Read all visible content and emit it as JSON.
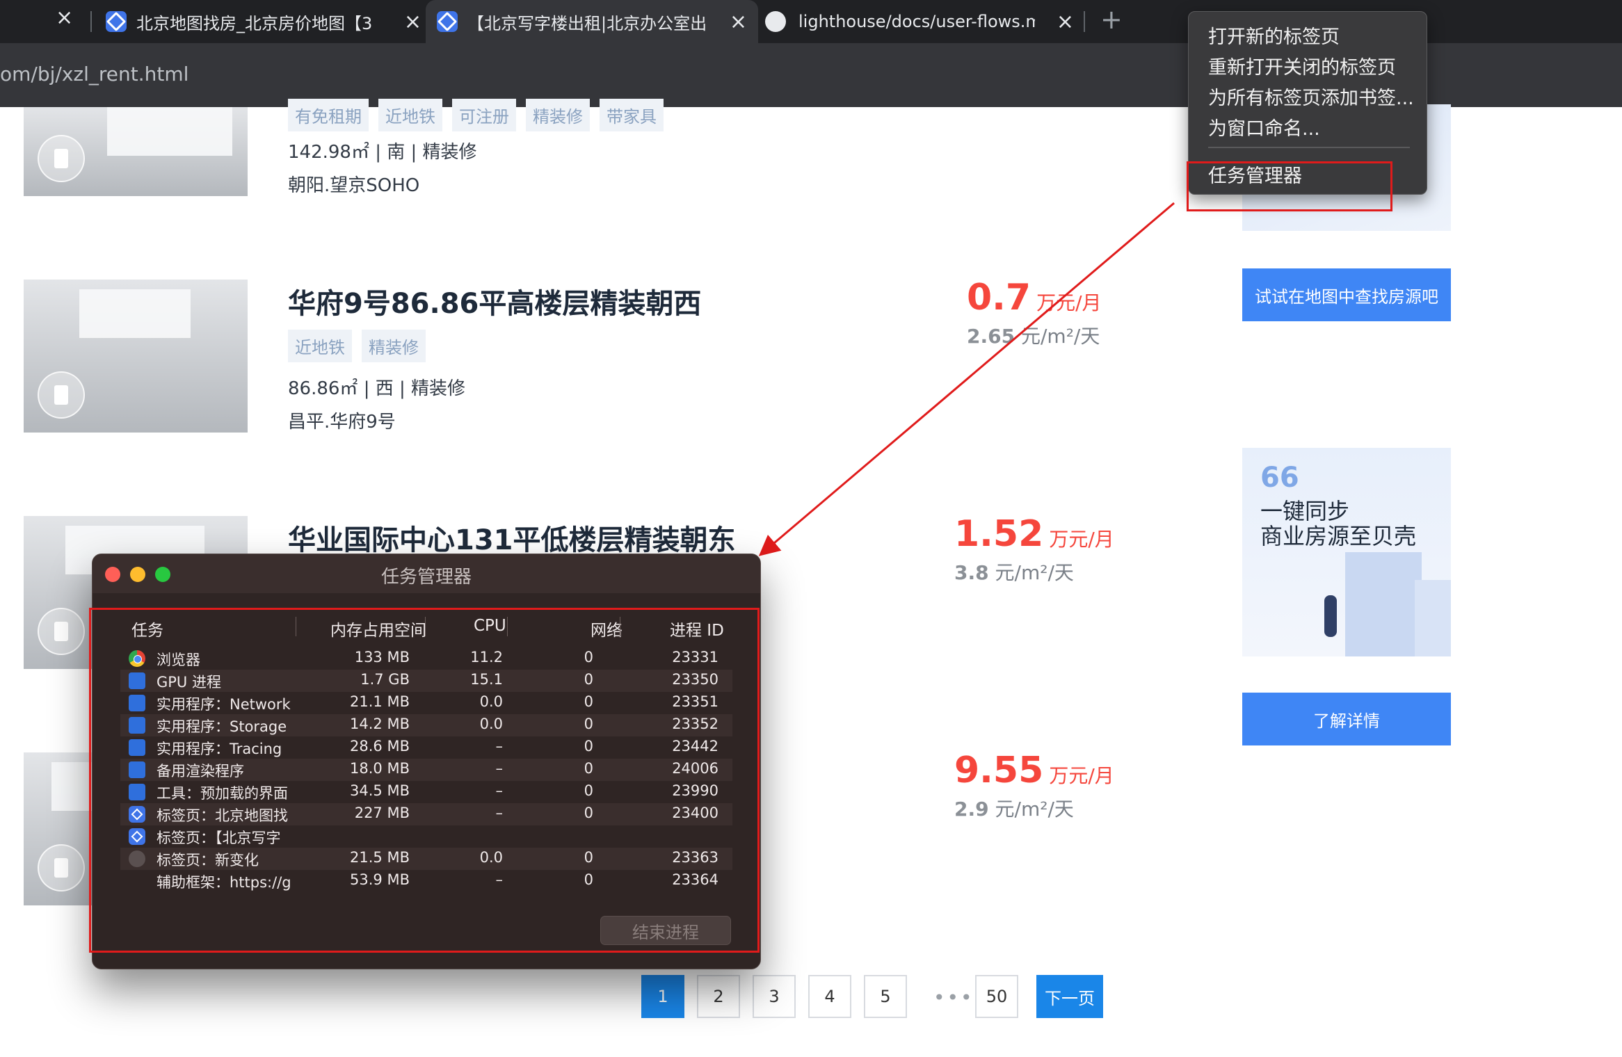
{
  "browser": {
    "tabs": [
      {
        "title": "北京地图找房_北京房价地图【3",
        "active": false
      },
      {
        "title": "【北京写字楼出租|北京办公室出",
        "active": true
      },
      {
        "title": "lighthouse/docs/user-flows.m",
        "active": false
      }
    ],
    "url": "om/bj/xzl_rent.html"
  },
  "listings": [
    {
      "tags": [
        "有免租期",
        "近地铁",
        "可注册",
        "精装修",
        "带家具"
      ],
      "meta": "142.98㎡ | 南 | 精装修",
      "location": "朝阳.望京SOHO"
    },
    {
      "title": "华府9号86.86平高楼层精装朝西",
      "tags": [
        "近地铁",
        "精装修"
      ],
      "meta": "86.86㎡ | 西 | 精装修",
      "location": "昌平.华府9号",
      "price": "0.7",
      "price_unit": "万元/月",
      "unit_price": "2.65",
      "unit_price_unit": "元/m²/天"
    },
    {
      "title": "华业国际中心131平低楼层精装朝东",
      "price": "1.52",
      "price_unit": "万元/月",
      "unit_price": "3.8",
      "unit_price_unit": "元/m²/天"
    },
    {
      "price": "9.55",
      "price_unit": "万元/月",
      "unit_price": "2.9",
      "unit_price_unit": "元/m²/天"
    }
  ],
  "sidebar": {
    "map_button": "试试在地图中查找房源吧",
    "ad_quote": "66",
    "ad_line1": "一键同步",
    "ad_line2": "商业房源至贝壳",
    "details_button": "了解详情"
  },
  "pagination": {
    "pages": [
      "1",
      "2",
      "3",
      "4",
      "5"
    ],
    "ellipsis": "•••",
    "last": "50",
    "next": "下一页",
    "current": "1"
  },
  "context_menu": {
    "items": [
      "打开新的标签页",
      "重新打开关闭的标签页",
      "为所有标签页添加书签...",
      "为窗口命名...",
      "任务管理器"
    ]
  },
  "task_manager": {
    "title": "任务管理器",
    "columns": [
      "任务",
      "内存占用空间",
      "CPU",
      "网络",
      "进程 ID"
    ],
    "rows": [
      {
        "icon": "chrome-icon",
        "task": "浏览器",
        "memory": "133 MB",
        "cpu": "11.2",
        "network": "0",
        "pid": "23331"
      },
      {
        "icon": "puzzle-icon",
        "task": "GPU 进程",
        "memory": "1.7 GB",
        "cpu": "15.1",
        "network": "0",
        "pid": "23350"
      },
      {
        "icon": "puzzle-icon",
        "task": "实用程序：Network",
        "memory": "21.1 MB",
        "cpu": "0.0",
        "network": "0",
        "pid": "23351"
      },
      {
        "icon": "puzzle-icon",
        "task": "实用程序：Storage",
        "memory": "14.2 MB",
        "cpu": "0.0",
        "network": "0",
        "pid": "23352"
      },
      {
        "icon": "puzzle-icon",
        "task": "实用程序：Tracing",
        "memory": "28.6 MB",
        "cpu": "–",
        "network": "0",
        "pid": "23442"
      },
      {
        "icon": "puzzle-icon",
        "task": "备用渲染程序",
        "memory": "18.0 MB",
        "cpu": "–",
        "network": "0",
        "pid": "24006"
      },
      {
        "icon": "puzzle-icon",
        "task": "工具：预加载的界面",
        "memory": "34.5 MB",
        "cpu": "–",
        "network": "0",
        "pid": "23990"
      },
      {
        "icon": "tab-icon",
        "task": "标签页：北京地图找",
        "memory": "227 MB",
        "cpu": "–",
        "network": "0",
        "pid": "23400"
      },
      {
        "icon": "tab-icon",
        "task": "标签页：【北京写字",
        "memory": "",
        "cpu": "",
        "network": "",
        "pid": ""
      },
      {
        "icon": "gray-icon",
        "task": "标签页：新变化",
        "memory": "21.5 MB",
        "cpu": "0.0",
        "network": "0",
        "pid": "23363"
      },
      {
        "icon": "",
        "task": "辅助框架：https://g",
        "memory": "53.9 MB",
        "cpu": "–",
        "network": "0",
        "pid": "23364"
      }
    ],
    "end_process": "结束进程"
  }
}
